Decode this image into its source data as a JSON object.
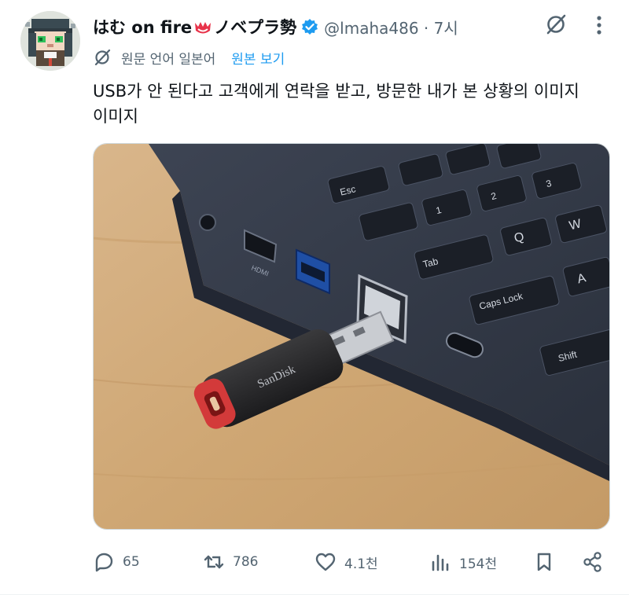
{
  "tweet": {
    "display_name_prefix": "はむ on fire",
    "display_name_suffix": "ノベプラ勢",
    "handle_and_time": "@lmaha486 · 7시",
    "translation_note": "원문 언어 일본어",
    "show_original_label": "원본 보기",
    "text_line1": "USB가 안 된다고 고객에게 연락을 받고, 방문한 내가 본 상황의 이미지",
    "text_line2": "이미지",
    "media": {
      "brand_text": "SanDisk",
      "keys": [
        "Esc",
        "Tab",
        "Caps Lock",
        "Shift",
        "Q",
        "W",
        "A",
        "1",
        "2",
        "3",
        "HDMI"
      ]
    }
  },
  "actions": {
    "replies": "65",
    "reposts": "786",
    "likes": "4.1천",
    "views": "154천"
  },
  "icons": [
    "avatar",
    "fire-emoji",
    "verified-icon",
    "grok-icon",
    "more-icon",
    "translate-icon",
    "reply-icon",
    "repost-icon",
    "like-icon",
    "views-icon",
    "bookmark-icon",
    "share-icon"
  ],
  "colors": {
    "accent": "#1d9bf0",
    "muted": "#536471",
    "text": "#0f1419"
  }
}
